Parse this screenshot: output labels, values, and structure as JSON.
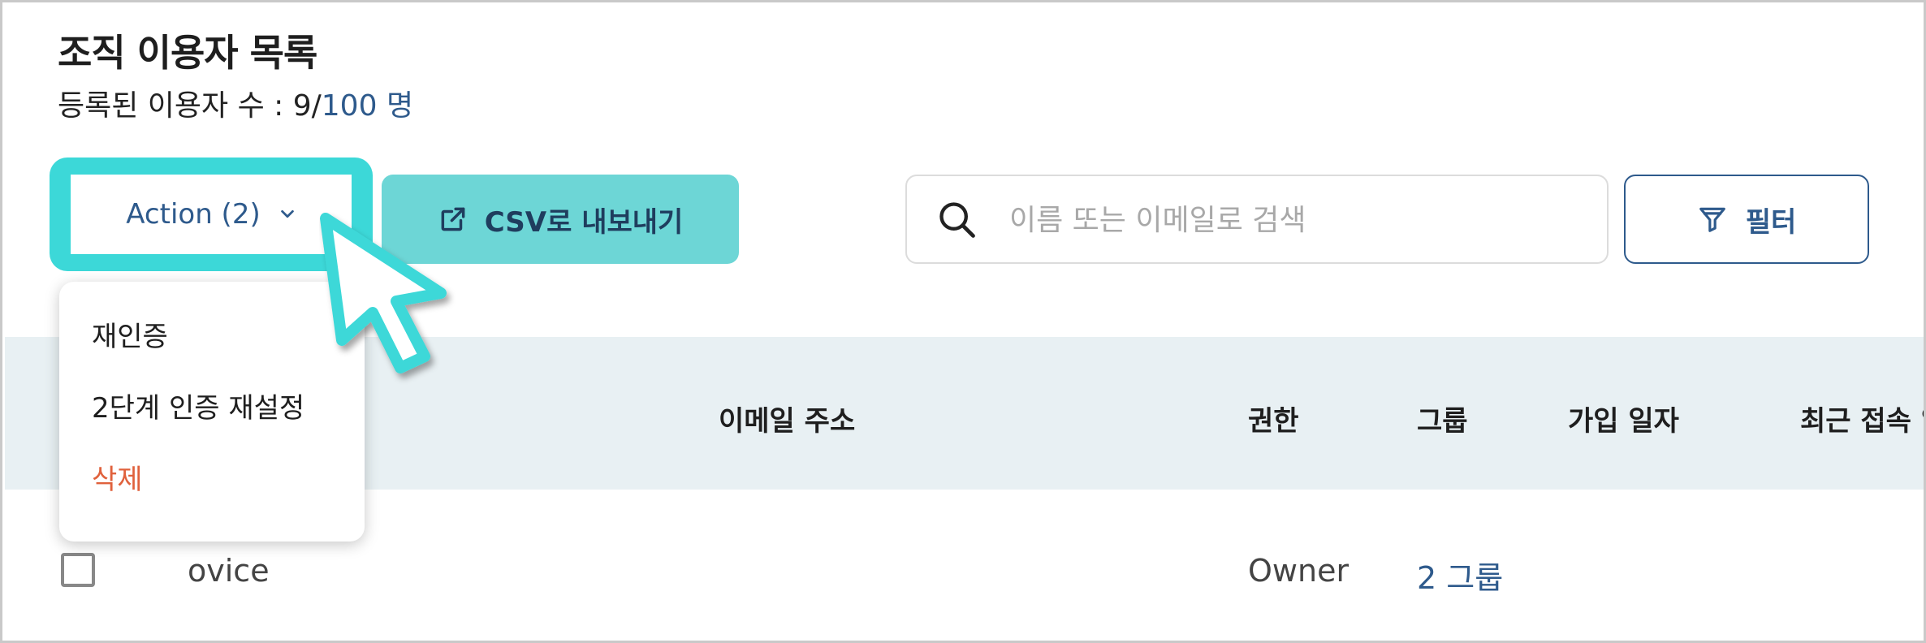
{
  "header": {
    "title": "조직 이용자 목록",
    "count_label": "등록된 이용자 수 : 9/",
    "count_limit": "100 명"
  },
  "toolbar": {
    "action_label": "Action (2)",
    "csv_label": "CSV로 내보내기",
    "search_placeholder": "이름 또는 이메일로 검색",
    "filter_label": "필터"
  },
  "action_menu": {
    "items": [
      {
        "label": "재인증"
      },
      {
        "label": "2단계 인증 재설정"
      },
      {
        "label": "삭제"
      }
    ]
  },
  "table": {
    "columns": [
      "이메일 주소",
      "권한",
      "그룹",
      "가입 일자",
      "최근 접속 일"
    ],
    "rows": [
      {
        "name": "ovice",
        "email": "",
        "role": "Owner",
        "groups": "2 그룹"
      }
    ]
  },
  "colors": {
    "accent": "#2e5a8c",
    "highlight": "#3cd8d8",
    "csv_button": "#6dd6d6",
    "danger": "#e0613c",
    "table_header_bg": "#e8f0f3"
  },
  "icons": [
    "chevron-down-icon",
    "external-link-icon",
    "search-icon",
    "filter-icon",
    "cursor-pointer-icon",
    "checkbox-icon"
  ]
}
